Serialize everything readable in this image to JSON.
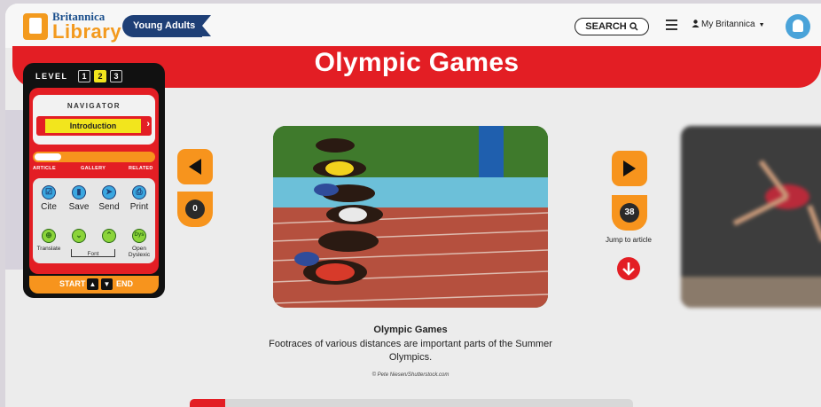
{
  "header": {
    "logo_top": "Britannica",
    "logo_bottom": "Library",
    "audience_badge": "Young Adults",
    "search_label": "SEARCH",
    "account_label": "My Britannica"
  },
  "page": {
    "title": "Olympic Games"
  },
  "navigator": {
    "level_label": "LEVEL",
    "levels": [
      "1",
      "2",
      "3"
    ],
    "active_level": "2",
    "heading": "NAVIGATOR",
    "section": "Introduction",
    "progress": 0.0,
    "tabs": [
      "ARTICLE",
      "GALLERY",
      "RELATED"
    ],
    "tools": {
      "cite": "Cite",
      "save": "Save",
      "send": "Send",
      "print": "Print",
      "translate": "Translate",
      "font": "Font",
      "open_dyslexic": "Open Dyslexic",
      "dys_icon": "Dys"
    },
    "footer": {
      "start": "START",
      "end": "END"
    }
  },
  "gallery": {
    "prev_count": "0",
    "next_count": "38",
    "jump_label": "Jump to article",
    "caption_title": "Olympic Games",
    "caption_text": "Footraces of various distances are important parts of the Summer Olympics.",
    "credit": "© Pete Niesen/Shutterstock.com"
  },
  "colors": {
    "brand_red": "#e31e24",
    "brand_orange": "#f7941d",
    "brand_navy": "#1e3f76",
    "highlight_yellow": "#f2e51d"
  },
  "icons": [
    "search-icon",
    "menu-icon",
    "user-icon",
    "globe-icon",
    "chevron-right-icon",
    "cite-icon",
    "save-icon",
    "send-icon",
    "print-icon",
    "translate-icon",
    "font-decrease-icon",
    "font-increase-icon",
    "prev-arrow-icon",
    "next-arrow-icon",
    "down-arrow-icon"
  ]
}
